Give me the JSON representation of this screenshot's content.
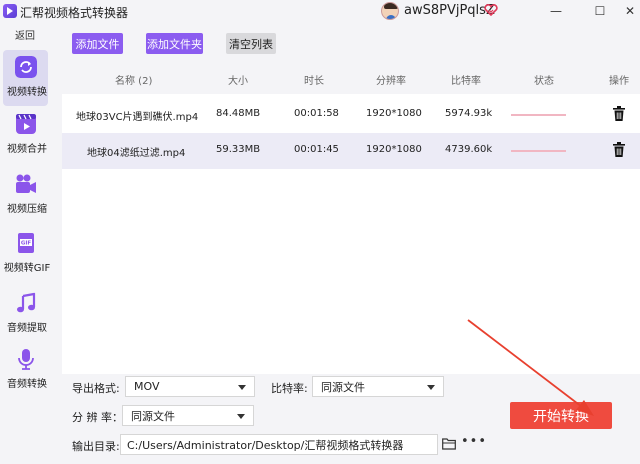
{
  "window": {
    "title": "汇帮视频格式转换器",
    "user_name": "awS8PVjPqlsZ",
    "minimize_glyph": "—",
    "maximize_glyph": "☐",
    "close_glyph": "✕"
  },
  "sidebar": {
    "back_label": "返回",
    "items": [
      {
        "label": "视频转换",
        "icon": "video-convert-icon",
        "active": true
      },
      {
        "label": "视频合并",
        "icon": "video-merge-icon",
        "active": false
      },
      {
        "label": "视频压缩",
        "icon": "video-compress-icon",
        "active": false
      },
      {
        "label": "视频转GIF",
        "icon": "gif-icon",
        "active": false
      },
      {
        "label": "音频提取",
        "icon": "music-note-icon",
        "active": false
      },
      {
        "label": "音频转换",
        "icon": "microphone-icon",
        "active": false
      }
    ]
  },
  "toolbar": {
    "add_file": "添加文件",
    "add_folder": "添加文件夹",
    "clear_list": "清空列表"
  },
  "table": {
    "headers": {
      "name": "名称 (2)",
      "size": "大小",
      "duration": "时长",
      "resolution": "分辨率",
      "bitrate": "比特率",
      "status": "状态",
      "action": "操作"
    },
    "rows": [
      {
        "name": "地球03VC片遇到礁伏.mp4",
        "size": "84.48MB",
        "duration": "00:01:58",
        "resolution": "1920*1080",
        "bitrate": "5974.93k"
      },
      {
        "name": "地球04滤纸过滤.mp4",
        "size": "59.33MB",
        "duration": "00:01:45",
        "resolution": "1920*1080",
        "bitrate": "4739.60k"
      }
    ]
  },
  "settings": {
    "format_label": "导出格式:",
    "format_value": "MOV",
    "bitrate_label": "比特率:",
    "bitrate_value": "同源文件",
    "resolution_label": "分 辨 率：",
    "resolution_value": "同源文件",
    "output_label": "输出目录:",
    "output_path": "C:/Users/Administrator/Desktop/汇帮视频格式转换器",
    "more_glyph": "•••",
    "start_label": "开始转换"
  },
  "colors": {
    "accent": "#8b5cf0",
    "start": "#ef4b3f",
    "active_nav": "#dcdaf0",
    "arrow": "#e8402f"
  }
}
